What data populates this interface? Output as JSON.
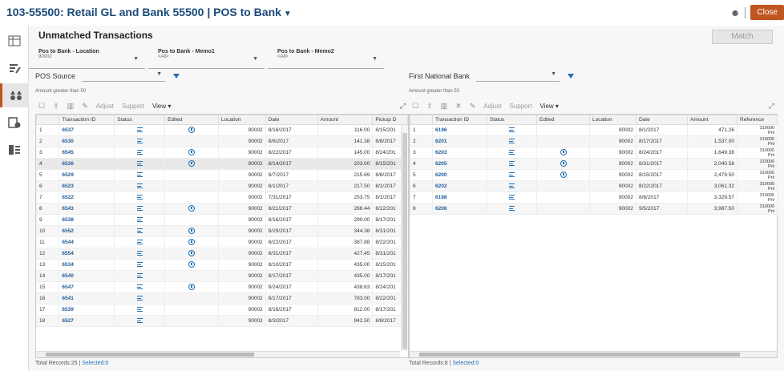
{
  "title": "103-55500: Retail GL and Bank 55500 | POS to Bank",
  "header_actions": {
    "close_label": "Close"
  },
  "section_title": "Unmatched Transactions",
  "match_button": "Match",
  "filters": [
    {
      "label": "Pos to Bank - Location",
      "value": "90002"
    },
    {
      "label": "Pos to Bank - Memo1",
      "value": "<All>"
    },
    {
      "label": "Pos to Bank - Memo2",
      "value": "<All>"
    }
  ],
  "left": {
    "source_label": "POS Source",
    "amount_filter": "Amount greater than 50",
    "toolbar": {
      "adjust": "Adjust",
      "support": "Support",
      "view": "View"
    },
    "columns": [
      "",
      "Transaction ID",
      "Status",
      "Edited",
      "Location",
      "Date",
      "Amount",
      "Pickup D"
    ],
    "rows": [
      {
        "n": "1",
        "id": "6537",
        "edited": true,
        "loc": "90002",
        "date": "8/16/2017",
        "amt": "116.00",
        "pick": "8/15/201"
      },
      {
        "n": "2",
        "id": "6530",
        "edited": false,
        "loc": "90002",
        "date": "8/8/2017",
        "amt": "141.38",
        "pick": "8/8/2017"
      },
      {
        "n": "3",
        "id": "6545",
        "edited": true,
        "loc": "90002",
        "date": "8/22/2017",
        "amt": "145.00",
        "pick": "8/24/201"
      },
      {
        "n": "4",
        "id": "6536",
        "edited": true,
        "loc": "90002",
        "date": "8/14/2017",
        "amt": "203.00",
        "pick": "8/15/201"
      },
      {
        "n": "5",
        "id": "6529",
        "edited": false,
        "loc": "90002",
        "date": "8/7/2017",
        "amt": "215.69",
        "pick": "8/8/2017"
      },
      {
        "n": "6",
        "id": "6523",
        "edited": false,
        "loc": "90002",
        "date": "8/1/2017",
        "amt": "217.50",
        "pick": "8/1/2017"
      },
      {
        "n": "7",
        "id": "6522",
        "edited": false,
        "loc": "90002",
        "date": "7/31/2017",
        "amt": "253.75",
        "pick": "8/1/2017"
      },
      {
        "n": "8",
        "id": "6543",
        "edited": true,
        "loc": "90002",
        "date": "8/21/2017",
        "amt": "266.44",
        "pick": "8/22/201"
      },
      {
        "n": "9",
        "id": "6538",
        "edited": false,
        "loc": "90002",
        "date": "8/16/2017",
        "amt": "290.00",
        "pick": "8/17/201"
      },
      {
        "n": "10",
        "id": "6552",
        "edited": true,
        "loc": "90002",
        "date": "8/29/2017",
        "amt": "344.38",
        "pick": "8/31/201"
      },
      {
        "n": "11",
        "id": "6544",
        "edited": true,
        "loc": "90002",
        "date": "8/22/2017",
        "amt": "387.88",
        "pick": "8/22/201"
      },
      {
        "n": "12",
        "id": "6554",
        "edited": true,
        "loc": "90002",
        "date": "8/31/2017",
        "amt": "427.45",
        "pick": "8/31/201"
      },
      {
        "n": "13",
        "id": "6534",
        "edited": true,
        "loc": "90002",
        "date": "8/10/2017",
        "amt": "435.00",
        "pick": "8/15/201"
      },
      {
        "n": "14",
        "id": "6540",
        "edited": false,
        "loc": "90002",
        "date": "8/17/2017",
        "amt": "435.00",
        "pick": "8/17/201"
      },
      {
        "n": "15",
        "id": "6547",
        "edited": true,
        "loc": "90002",
        "date": "8/24/2017",
        "amt": "438.63",
        "pick": "8/24/201"
      },
      {
        "n": "16",
        "id": "6541",
        "edited": false,
        "loc": "90002",
        "date": "8/17/2017",
        "amt": "783.00",
        "pick": "8/22/201"
      },
      {
        "n": "17",
        "id": "6539",
        "edited": false,
        "loc": "90002",
        "date": "8/16/2017",
        "amt": "812.00",
        "pick": "8/17/201"
      },
      {
        "n": "18",
        "id": "6527",
        "edited": false,
        "loc": "90002",
        "date": "8/3/2017",
        "amt": "942.50",
        "pick": "8/8/2017"
      }
    ],
    "footer": {
      "total": "Total Records:25",
      "selected": "Selected:0"
    }
  },
  "right": {
    "source_label": "First National Bank",
    "amount_filter": "Amount greater than 50",
    "toolbar": {
      "adjust": "Adjust",
      "support": "Support",
      "view": "View"
    },
    "columns": [
      "",
      "Transaction ID",
      "Status",
      "Edited",
      "Location",
      "Date",
      "Amount",
      "Reference"
    ],
    "rows": [
      {
        "n": "1",
        "id": "6196",
        "edited": false,
        "loc": "90002",
        "date": "8/1/2017",
        "amt": "471.26",
        "ref1": "310000",
        "ref2": "Prii"
      },
      {
        "n": "2",
        "id": "6201",
        "edited": false,
        "loc": "90002",
        "date": "8/17/2017",
        "amt": "1,537.00",
        "ref1": "310000",
        "ref2": "Prii"
      },
      {
        "n": "3",
        "id": "6203",
        "edited": true,
        "loc": "90002",
        "date": "8/24/2017",
        "amt": "1,649.38",
        "ref1": "310000",
        "ref2": "Prii"
      },
      {
        "n": "4",
        "id": "6205",
        "edited": true,
        "loc": "90002",
        "date": "8/31/2017",
        "amt": "2,040.58",
        "ref1": "310000",
        "ref2": "Prii"
      },
      {
        "n": "5",
        "id": "6200",
        "edited": true,
        "loc": "90002",
        "date": "8/15/2017",
        "amt": "2,479.50",
        "ref1": "310000",
        "ref2": "Prii"
      },
      {
        "n": "6",
        "id": "6202",
        "edited": false,
        "loc": "90002",
        "date": "8/22/2017",
        "amt": "3,061.32",
        "ref1": "310000",
        "ref2": "Prii"
      },
      {
        "n": "7",
        "id": "6198",
        "edited": false,
        "loc": "90002",
        "date": "8/8/2017",
        "amt": "3,329.57",
        "ref1": "310000",
        "ref2": "Prii"
      },
      {
        "n": "8",
        "id": "6206",
        "edited": false,
        "loc": "90002",
        "date": "9/5/2017",
        "amt": "3,987.50",
        "ref1": "310000",
        "ref2": "Prii"
      }
    ],
    "footer": {
      "total": "Total Records:8",
      "selected": "Selected:0"
    }
  }
}
